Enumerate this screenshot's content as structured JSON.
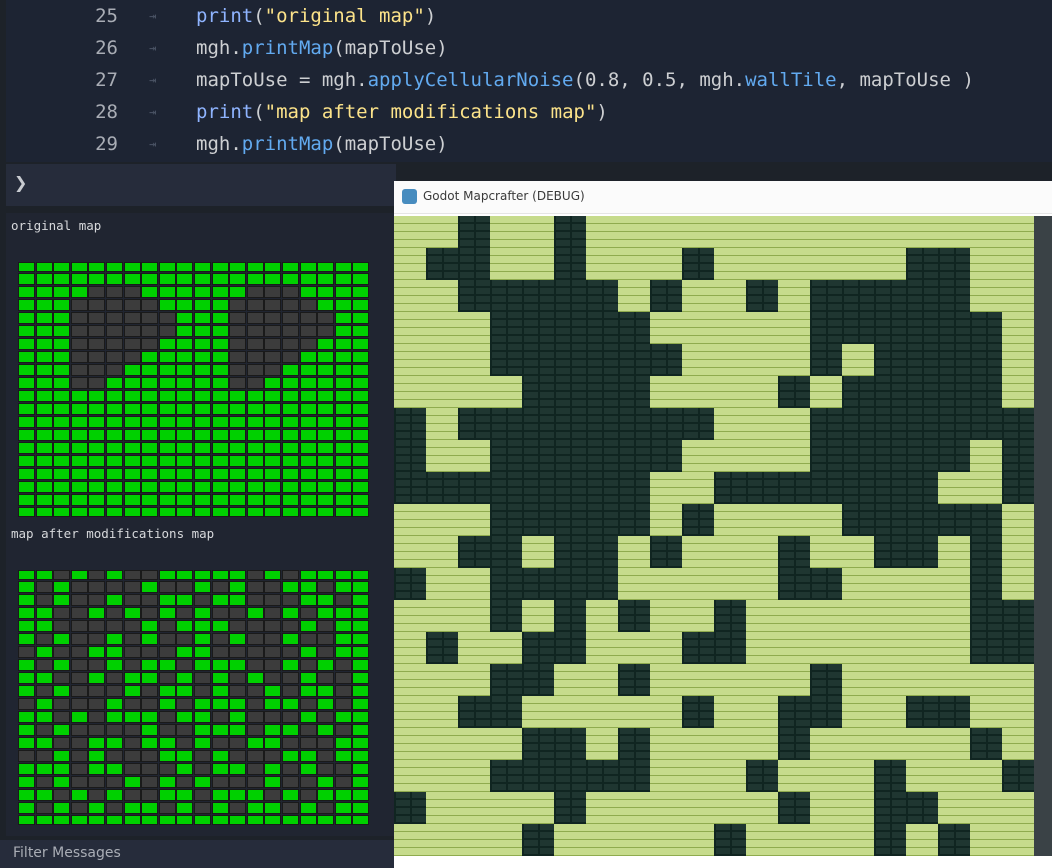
{
  "editor": {
    "lines": [
      {
        "num": "25",
        "tab": "⇥",
        "parts": [
          {
            "t": "print",
            "c": "kw"
          },
          {
            "t": "(",
            "c": ""
          },
          {
            "t": "\"original map\"",
            "c": "str"
          },
          {
            "t": ")",
            "c": ""
          }
        ]
      },
      {
        "num": "26",
        "tab": "⇥",
        "parts": [
          {
            "t": "mgh.",
            "c": ""
          },
          {
            "t": "printMap",
            "c": "fn"
          },
          {
            "t": "(mapToUse)",
            "c": ""
          }
        ]
      },
      {
        "num": "27",
        "tab": "⇥",
        "parts": [
          {
            "t": "mapToUse = mgh.",
            "c": ""
          },
          {
            "t": "applyCellularNoise",
            "c": "fn"
          },
          {
            "t": "(0.8, 0.5, mgh.",
            "c": ""
          },
          {
            "t": "wallTile",
            "c": "fn"
          },
          {
            "t": ", mapToUse )",
            "c": ""
          }
        ]
      },
      {
        "num": "28",
        "tab": "⇥",
        "parts": [
          {
            "t": "print",
            "c": "kw"
          },
          {
            "t": "(",
            "c": ""
          },
          {
            "t": "\"map after modifications map\"",
            "c": "str"
          },
          {
            "t": ")",
            "c": ""
          }
        ]
      },
      {
        "num": "29",
        "tab": "⇥",
        "parts": [
          {
            "t": "mgh.",
            "c": ""
          },
          {
            "t": "printMap",
            "c": "fn"
          },
          {
            "t": "(mapToUse)",
            "c": ""
          }
        ]
      }
    ]
  },
  "bar": {
    "caret": "❯"
  },
  "output": {
    "original_label": "original map",
    "modified_label": "map after modifications map",
    "original_grid": [
      "FFFFFFFFFFFFFFFFFFFF",
      "FFFFFFFFFFFFFFFFFFFF",
      "FFFFWWWFFFFFFWWWFFFF",
      "FFFWWWWWFFFFWWWWWFFF",
      "FFFWWWWWWFFFWWWWWWFF",
      "FFFWWWWWWFFFWWWWWWFF",
      "FFFWWWWWFFFFWWWWWFFF",
      "FFFWWWWFFFFFWWWWFFFF",
      "FFFWWWFFFFFFWWWFFFFF",
      "FFFWWFFFFFFFWWFFFFFF",
      "FFFFFFFFFFFFFFFFFFFF",
      "FFFFFFFFFFFFFFFFFFFF",
      "FFFFFFFFFFFFFFFFFFFF",
      "FFFFFFFFFFFFFFFFFFFF",
      "FFFFFFFFFFFFFFFFFFFF",
      "FFFFFFFFFFFFFFFFFFFF",
      "FFFFFFFFFFFFFFFFFFFF",
      "FFFFFFFFFFFFFFFFFFFF",
      "FFFFFFFFFFFFFFFFFFFF",
      "FFFFFFFFFFFFFFFFFFFF"
    ],
    "modified_grid": [
      "FFWFWFWWFFFFFWFWFFFF",
      "FWFWWWWFWWFWFWWFFWFF",
      "FWFWWFWWFFWFFWWWFFWF",
      "FFWWFWFWFWFWWFWFWFFF",
      "FFWWWWWFWFFFWWWWFWFF",
      "FWFWWFWFWWFWFWWFWWFF",
      "WFWWFFWWWFFWWWWWFWFF",
      "FWFWWFWFFWFFFWWFWFWF",
      "FFWWFWFFWFWFWFWWFWWF",
      "FWFWWWFWFFWFWWFWFFWF",
      "WFWWWFWWFWFFFWFFWFWF",
      "FFWFWFFFWFFWFWWWFWFF",
      "FWFWWWWFWWFFFWFFWFWF",
      "FFWWFFWFFWFWWFFWWWFF",
      "WWFWFWWWFFWFWWWFFWFF",
      "FFFWFFWWWFWFFWFWFWWF",
      "FWFWWWFWFWFWWWFWWFWF",
      "FFWFWFWWFFWFFFWFWFFF",
      "FWFWFWFFWFWFWFFWFWFF",
      "FFFFFFFFFFFFFFFFFFFF"
    ]
  },
  "filter": {
    "label": "Filter Messages"
  },
  "window": {
    "title": "Godot Mapcrafter (DEBUG)",
    "tiles": [
      "FFWFFWFFFFFFFFFFFFFFW",
      "FWWFFWFFFWFFFFFFWWFF",
      "FFWWWWWFWFFWFWWWWWFF",
      "FFFWWWWWFFFFFWWWWWWF",
      "FFFWWWWWWFFFFWFWWWWF",
      "FFFFWWWWFFFFWFWWWWWF",
      "WFWWWWWWWWFFFWWWWWWW",
      "WFFWWWWWWFFFFWWWWWFW",
      "WWWWWWWWFFWWWWWWWFFW",
      "FFFWWWWWFWFFFFWWWWWF",
      "FFWWFWWFWFFFWFFWWFWF",
      "WFFWWWWFFFFFWWFFFFWF",
      "FFFWFWFWFFWFFFFFFFWW",
      "FWFFWWFFFWWFFFFFFFWW",
      "FFFWWFFWFFFFFWFFFFFF",
      "FFWWFFFFFWFFWWFFWWFF",
      "FFFFWWFWFFFFWFFFFFWF",
      "FFFWWWWWFFFWFFFWFFFW",
      "WFFFFWFFFFFFWFFWWFFF",
      "FFFFWFFFFFWFFFFWFWFF"
    ]
  }
}
